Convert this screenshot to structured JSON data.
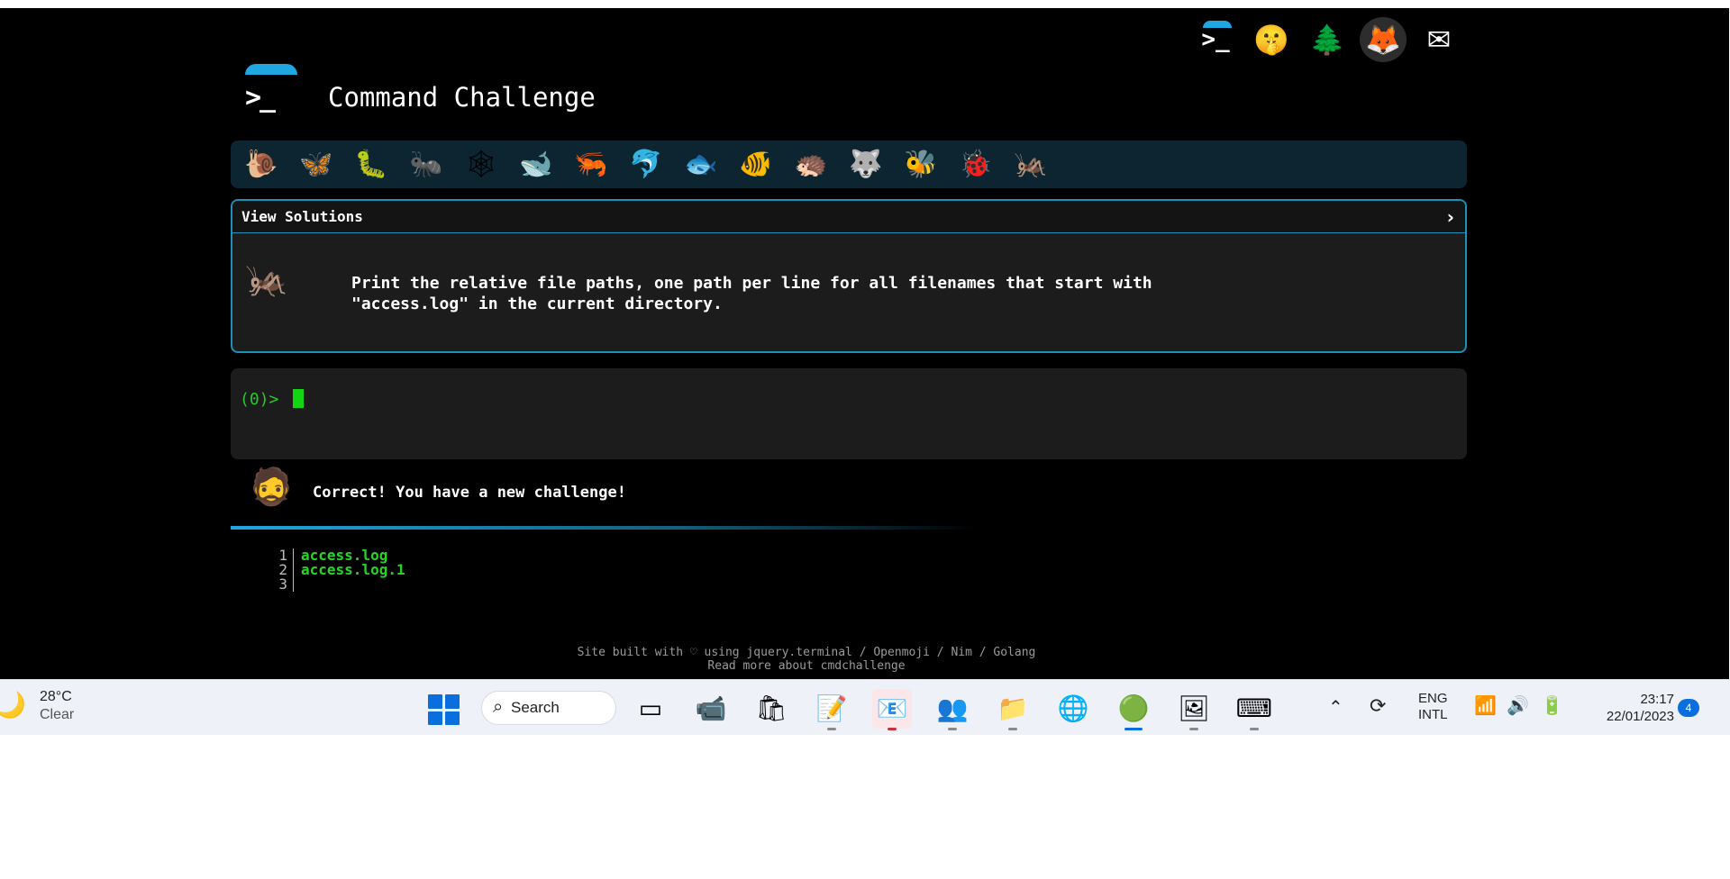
{
  "header": {
    "title": "Command Challenge",
    "logo_prompt": ">_"
  },
  "top_icons": [
    {
      "name": "terminal-icon",
      "glyph": ">_"
    },
    {
      "name": "shushing-face-icon",
      "glyph": "🤫"
    },
    {
      "name": "tree-icon",
      "glyph": "🌲"
    },
    {
      "name": "gitlab-fox-icon",
      "glyph": "🦊"
    },
    {
      "name": "envelope-icon",
      "glyph": "✉"
    }
  ],
  "animals": [
    {
      "name": "snail-icon",
      "glyph": "🐌"
    },
    {
      "name": "butterfly-icon",
      "glyph": "🦋"
    },
    {
      "name": "caterpillar-icon",
      "glyph": "🐛"
    },
    {
      "name": "ant-icon",
      "glyph": "🐜"
    },
    {
      "name": "spider-web-icon",
      "glyph": "🕸"
    },
    {
      "name": "whale-icon",
      "glyph": "🐋"
    },
    {
      "name": "shrimp-icon",
      "glyph": "🦐"
    },
    {
      "name": "dolphin-icon",
      "glyph": "🐬"
    },
    {
      "name": "fish-icon",
      "glyph": "🐟"
    },
    {
      "name": "tropical-fish-icon",
      "glyph": "🐠"
    },
    {
      "name": "hedgehog-icon",
      "glyph": "🦔"
    },
    {
      "name": "wolf-icon",
      "glyph": "🐺"
    },
    {
      "name": "bee-icon",
      "glyph": "🐝"
    },
    {
      "name": "ladybug-icon",
      "glyph": "🐞"
    },
    {
      "name": "cricket-icon",
      "glyph": "🦗"
    }
  ],
  "challenge": {
    "solutions_label": "View Solutions",
    "chevron": "›",
    "text": "Print the relative file paths, one path per line for all filenames that start with\n\"access.log\" in the current directory.",
    "icon": "🦗"
  },
  "terminal": {
    "prompt": "(0)>"
  },
  "feedback": {
    "avatar": "🧔",
    "message": "Correct! You have a new challenge!"
  },
  "output": {
    "lines": [
      {
        "num": "1",
        "text": "access.log"
      },
      {
        "num": "2",
        "text": "access.log.1"
      },
      {
        "num": "3",
        "text": ""
      }
    ]
  },
  "footer": {
    "line1": "Site built with ♡ using jquery.terminal / Openmoji / Nim / Golang",
    "line2": "Read more about cmdchallenge"
  },
  "taskbar": {
    "weather_temp": "28°C",
    "weather_condition": "Clear",
    "search_label": "Search",
    "apps": [
      {
        "name": "task-view-icon",
        "glyph": "▭"
      },
      {
        "name": "meet-icon",
        "glyph": "📹"
      },
      {
        "name": "store-icon",
        "glyph": "🛍"
      },
      {
        "name": "sticky-notes-icon",
        "glyph": "📝"
      },
      {
        "name": "outlook-icon",
        "glyph": "📧"
      },
      {
        "name": "teams-icon",
        "glyph": "👥"
      },
      {
        "name": "file-explorer-icon",
        "glyph": "📁"
      },
      {
        "name": "edge-icon",
        "glyph": "🌐"
      },
      {
        "name": "chrome-icon",
        "glyph": "🟢"
      },
      {
        "name": "photos-icon",
        "glyph": "🖼"
      },
      {
        "name": "terminal-app-icon",
        "glyph": "⌨"
      }
    ],
    "lang_line1": "ENG",
    "lang_line2": "INTL",
    "time": "23:17",
    "date": "22/01/2023",
    "notification_count": "4"
  }
}
